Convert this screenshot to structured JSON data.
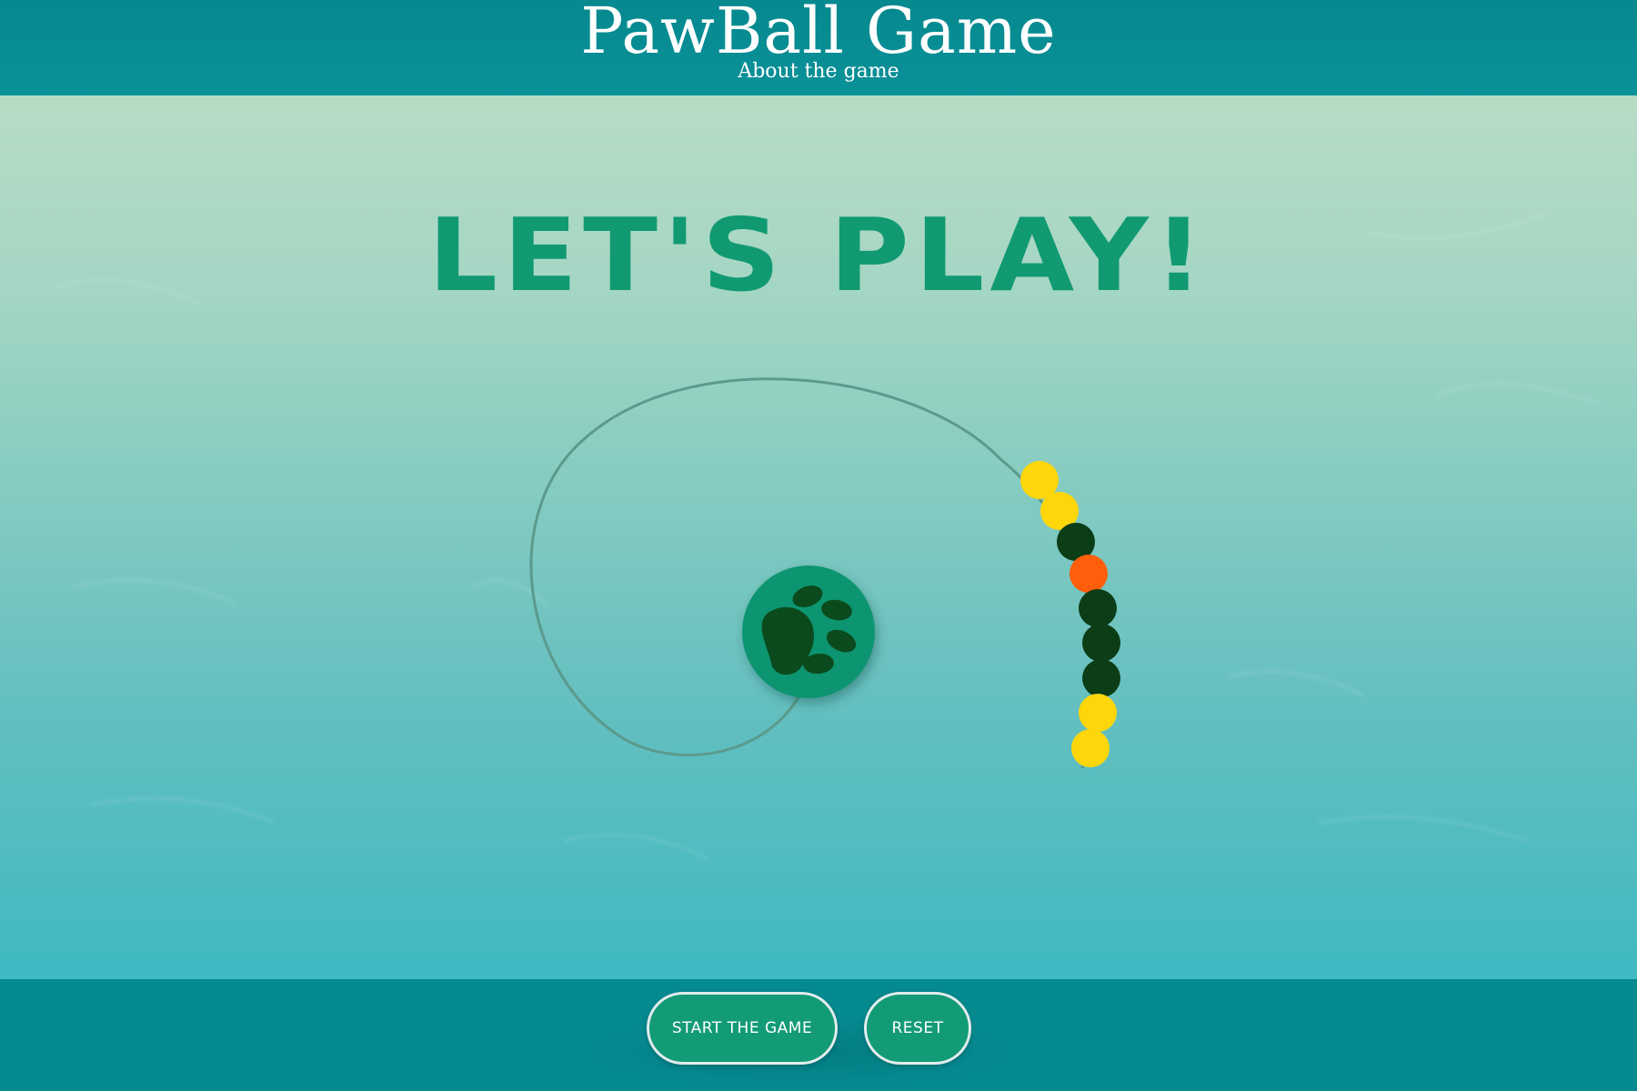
{
  "header": {
    "title": "PawBall Game",
    "subtitle": "About the game"
  },
  "stage": {
    "headline": "LET'S PLAY!",
    "launcher_icon": "paw-print-icon",
    "ball_chain": [
      "yellow",
      "yellow",
      "dark-green",
      "orange",
      "dark-green",
      "dark-green",
      "dark-green",
      "yellow",
      "yellow"
    ]
  },
  "controls": {
    "start_label": "START THE GAME",
    "reset_label": "RESET"
  },
  "colors": {
    "header_bg": "#06898f",
    "headline": "#119a72",
    "launcher": "#0f9470",
    "paw": "#0a4a1c",
    "yellow": "#ffd60a",
    "dark-green": "#0b3d16",
    "orange": "#ff5e0a",
    "track": "#5b9a8c",
    "button_bg": "#139b77"
  }
}
